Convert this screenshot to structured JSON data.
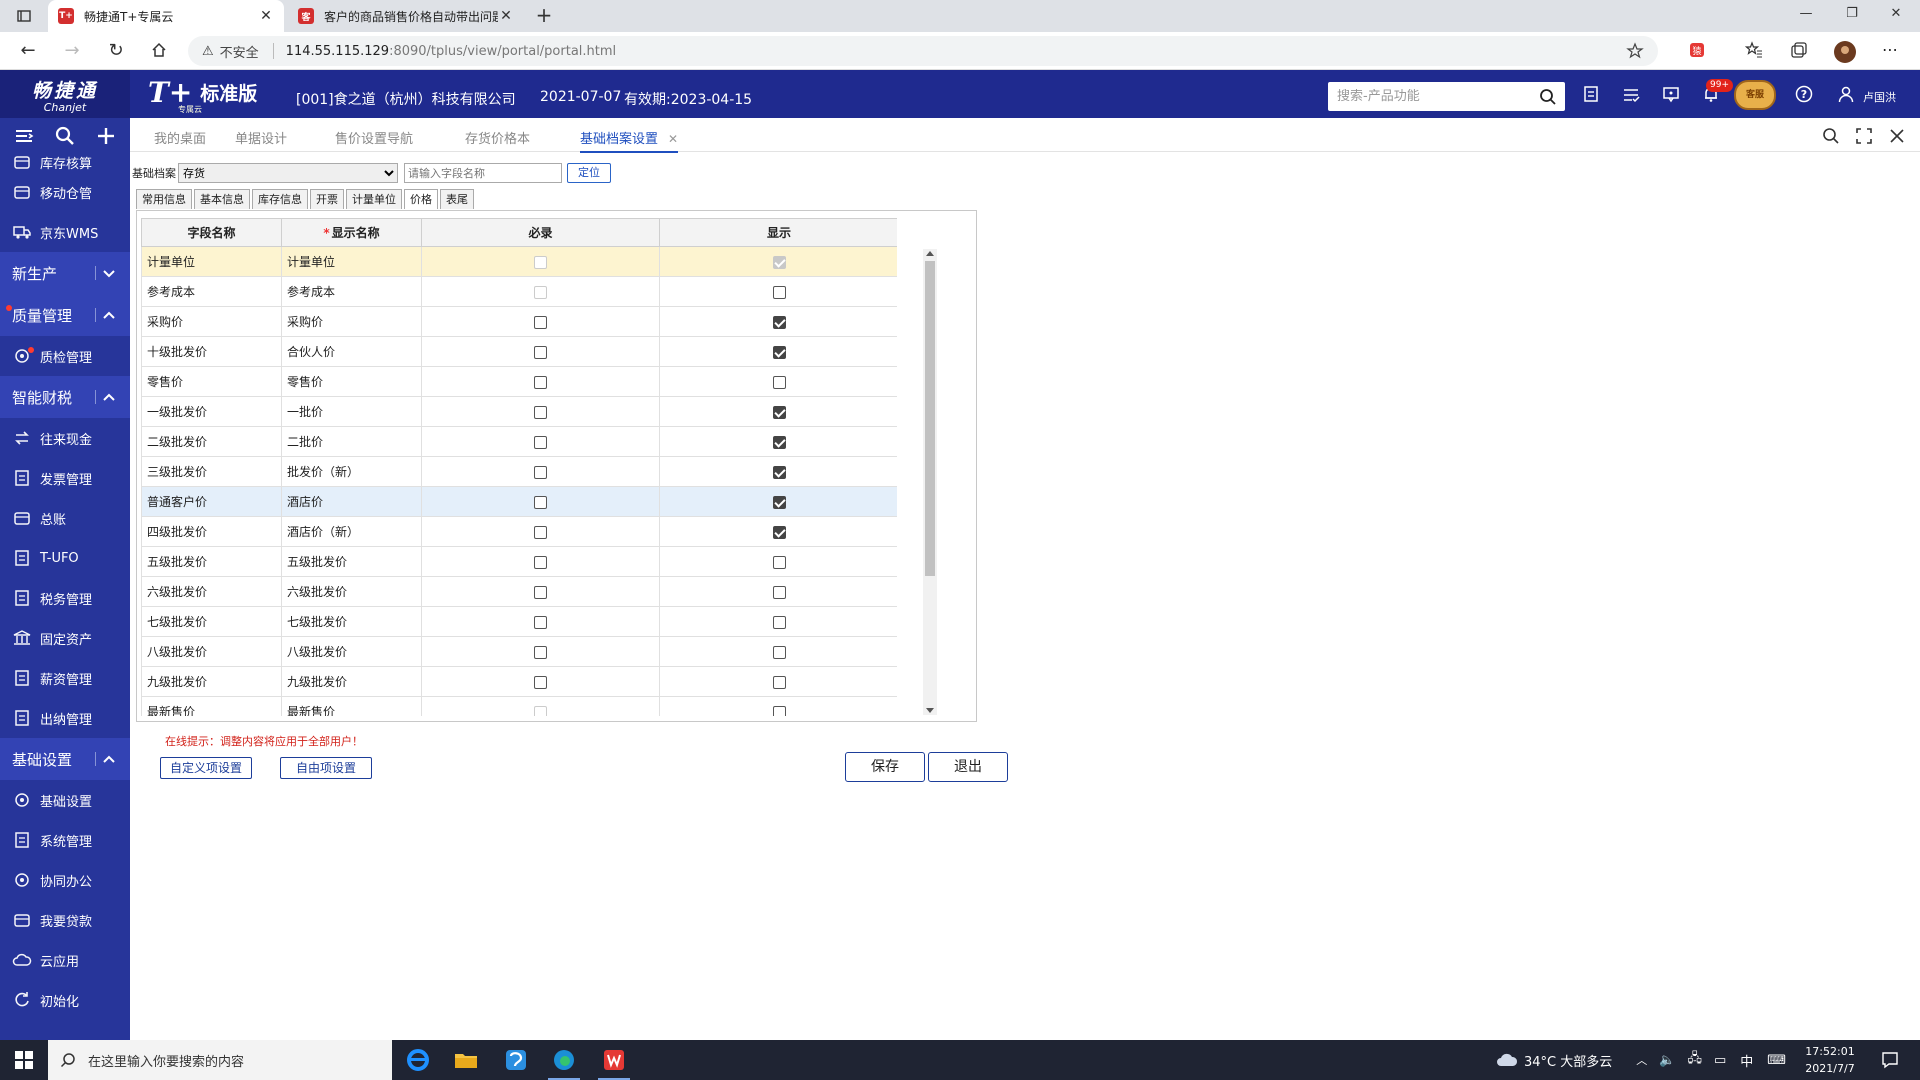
{
  "browser": {
    "tabs": [
      {
        "title": "畅捷通T+专属云",
        "favicon": "T+",
        "color": "#d32f2f"
      },
      {
        "title": "客户的商品销售价格自动带出问题",
        "favicon": "客",
        "color": "#d32f2f"
      }
    ],
    "security_label": "不安全",
    "url_host": "114.55.115.129",
    "url_rest": ":8090/tplus/view/portal/portal.html"
  },
  "header": {
    "logo_cn": "畅捷通",
    "logo_en": "Chanjet",
    "product": "T+",
    "product_sub": "专属云",
    "edition": "标准版",
    "company": "[001]食之道（杭州）科技有限公司",
    "date": "2021-07-07",
    "expiry": "有效期:2023-04-15",
    "search_placeholder": "搜索-产品功能",
    "badge": "99+",
    "mascot": "客服",
    "username": "卢国洪"
  },
  "sidebar": {
    "items": [
      {
        "label": "库存核算",
        "icon": "inventory-icon",
        "partial": true
      },
      {
        "label": "移动仓管",
        "icon": "mobile-warehouse-icon"
      },
      {
        "label": "京东WMS",
        "icon": "truck-icon"
      },
      {
        "group": "新生产",
        "expanded": false
      },
      {
        "group": "质量管理",
        "expanded": true,
        "dot": true
      },
      {
        "label": "质检管理",
        "icon": "quality-check-icon",
        "dot": true
      },
      {
        "group": "智能财税",
        "expanded": true
      },
      {
        "label": "往来现金",
        "icon": "exchange-icon"
      },
      {
        "label": "发票管理",
        "icon": "invoice-icon"
      },
      {
        "label": "总账",
        "icon": "ledger-icon"
      },
      {
        "label": "T-UFO",
        "icon": "report-icon"
      },
      {
        "label": "税务管理",
        "icon": "tax-icon"
      },
      {
        "label": "固定资产",
        "icon": "asset-icon"
      },
      {
        "label": "薪资管理",
        "icon": "salary-icon"
      },
      {
        "label": "出纳管理",
        "icon": "cashier-icon"
      },
      {
        "group": "基础设置",
        "expanded": true
      },
      {
        "label": "基础设置",
        "icon": "settings-icon"
      },
      {
        "label": "系统管理",
        "icon": "system-icon"
      },
      {
        "label": "协同办公",
        "icon": "collab-icon"
      },
      {
        "label": "我要贷款",
        "icon": "loan-icon"
      },
      {
        "label": "云应用",
        "icon": "cloud-icon"
      },
      {
        "label": "初始化",
        "icon": "init-icon"
      }
    ]
  },
  "worktabs": {
    "items": [
      "我的桌面",
      "单据设计",
      "售价设置导航",
      "存货价格本",
      "基础档案设置"
    ],
    "active": 4
  },
  "filter": {
    "label": "基础档案",
    "selected": "存货",
    "field_placeholder": "请输入字段名称",
    "locate_label": "定位"
  },
  "subtabs": {
    "items": [
      "常用信息",
      "基本信息",
      "库存信息",
      "开票",
      "计量单位",
      "价格",
      "表尾"
    ],
    "active": 5
  },
  "grid": {
    "columns": [
      "字段名称",
      "显示名称",
      "必录",
      "显示"
    ],
    "rows": [
      {
        "field": "计量单位",
        "display": "计量单位",
        "required": true,
        "required_disabled": true,
        "show": true,
        "show_disabled": true,
        "hl": "yellow"
      },
      {
        "field": "参考成本",
        "display": "参考成本",
        "required": false,
        "required_disabled": true,
        "show": false
      },
      {
        "field": "采购价",
        "display": "采购价",
        "required": false,
        "show": true
      },
      {
        "field": "十级批发价",
        "display": "合伙人价",
        "required": false,
        "show": true
      },
      {
        "field": "零售价",
        "display": "零售价",
        "required": false,
        "show": false
      },
      {
        "field": "一级批发价",
        "display": "一批价",
        "required": false,
        "show": true
      },
      {
        "field": "二级批发价",
        "display": "二批价",
        "required": false,
        "show": true
      },
      {
        "field": "三级批发价",
        "display": "批发价（新）",
        "required": false,
        "show": true
      },
      {
        "field": "普通客户价",
        "display": "酒店价",
        "required": false,
        "show": true,
        "hl": "blue"
      },
      {
        "field": "四级批发价",
        "display": "酒店价（新）",
        "required": false,
        "show": true
      },
      {
        "field": "五级批发价",
        "display": "五级批发价",
        "required": false,
        "show": false
      },
      {
        "field": "六级批发价",
        "display": "六级批发价",
        "required": false,
        "show": false
      },
      {
        "field": "七级批发价",
        "display": "七级批发价",
        "required": false,
        "show": false
      },
      {
        "field": "八级批发价",
        "display": "八级批发价",
        "required": false,
        "show": false
      },
      {
        "field": "九级批发价",
        "display": "九级批发价",
        "required": false,
        "show": false
      },
      {
        "field": "最新售价",
        "display": "最新售价",
        "required": false,
        "required_disabled": true,
        "show": false
      }
    ]
  },
  "footer": {
    "tip": "在线提示：调整内容将应用于全部用户！",
    "custom_btn": "自定义项设置",
    "free_btn": "自由项设置",
    "save": "保存",
    "exit": "退出"
  },
  "taskbar": {
    "search_placeholder": "在这里输入你要搜索的内容",
    "weather": "34°C 大部多云",
    "ime": "中",
    "time": "17:52:01",
    "date": "2021/7/7"
  }
}
